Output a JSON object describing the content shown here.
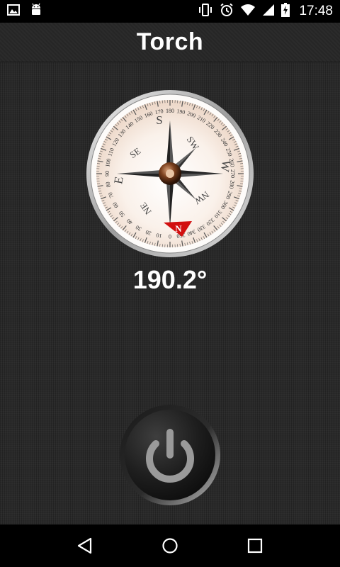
{
  "status_bar": {
    "time": "17:48",
    "icons": [
      "gallery-icon",
      "android-icon",
      "vibrate-icon",
      "alarm-icon",
      "wifi-icon",
      "signal-icon",
      "battery-charging-icon"
    ]
  },
  "app": {
    "title": "Torch"
  },
  "compass": {
    "heading": "190.2°",
    "heading_value": 190.2,
    "cardinals": {
      "n": "N",
      "s": "S",
      "e": "E",
      "w": "W"
    },
    "intercardinals": {
      "ne": "NE",
      "nw": "NW",
      "se": "SE",
      "sw": "SW"
    },
    "degree_labels": [
      "0",
      "10",
      "20",
      "30",
      "40",
      "50",
      "60",
      "70",
      "80",
      "90",
      "100",
      "110",
      "120",
      "130",
      "140",
      "150",
      "160",
      "170",
      "180",
      "190",
      "200",
      "210",
      "220",
      "230",
      "240",
      "250",
      "260",
      "270",
      "280",
      "290",
      "300",
      "310",
      "320",
      "330",
      "340",
      "350"
    ]
  },
  "power_button": {
    "icon": "power-icon",
    "state": "off"
  },
  "nav": {
    "icons": [
      "back-icon",
      "home-icon",
      "recents-icon"
    ]
  },
  "colors": {
    "needle_red": "#d21010",
    "dial_face": "#f7ece4",
    "background": "#2a2a2a",
    "power_icon": "#9a9a9a"
  }
}
